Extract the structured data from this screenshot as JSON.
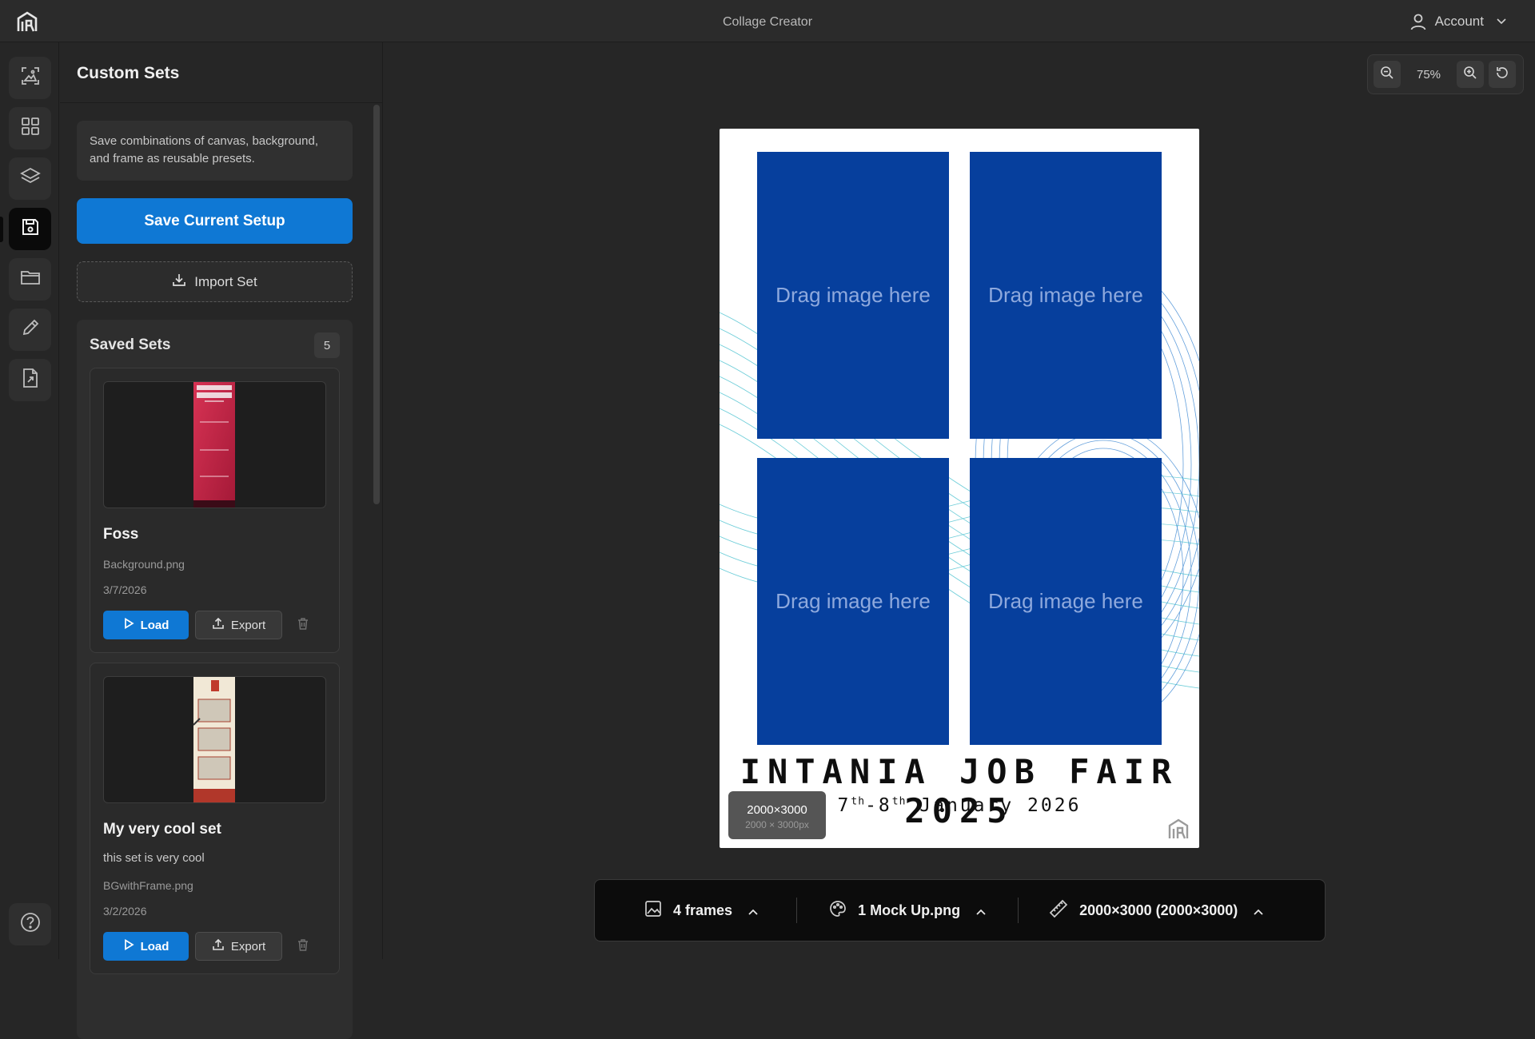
{
  "app": {
    "title": "Collage Creator"
  },
  "account": {
    "label": "Account"
  },
  "panel": {
    "title": "Custom Sets",
    "info": "Save combinations of canvas, background, and frame as reusable presets.",
    "save_label": "Save Current Setup",
    "import_label": "Import Set",
    "saved_title": "Saved Sets",
    "saved_count": "5",
    "sets": [
      {
        "name": "Foss",
        "desc": "",
        "background": "Background.png",
        "date": "3/7/2026"
      },
      {
        "name": "My very cool set",
        "desc": "this set is very cool",
        "background": "BGwithFrame.png",
        "date": "3/2/2026"
      }
    ],
    "load_label": "Load",
    "export_label": "Export"
  },
  "zoom": {
    "level": "75%"
  },
  "canvas": {
    "frames": [
      "Drag image here",
      "Drag image here",
      "Drag image here",
      "Drag image here"
    ],
    "title": "INTANIA JOB FAIR 2025",
    "date_d1": "7",
    "date_s1": "th",
    "date_d2": "-8",
    "date_s2": "th",
    "date_rest": " January 2026",
    "size_main": "2000×3000",
    "size_sub": "2000 × 3000px"
  },
  "toolbar": {
    "frames_label": "4 frames",
    "background_label": "1 Mock Up.png",
    "size_label": "2000×3000 (2000×3000)"
  },
  "colors": {
    "accent": "#0f78d4",
    "frame_fill": "#063f9d",
    "background": "#262626"
  },
  "icons": {
    "rail": [
      "image-crop-icon",
      "grid-icon",
      "layers-icon",
      "save-icon",
      "folder-icon",
      "pencil-icon",
      "file-export-icon"
    ],
    "help": "help-icon"
  }
}
